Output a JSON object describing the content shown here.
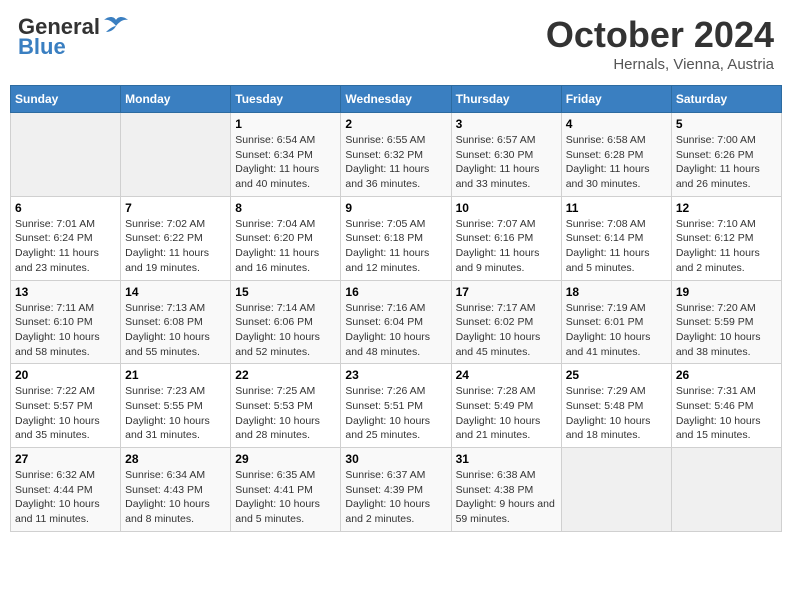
{
  "header": {
    "logo_general": "General",
    "logo_blue": "Blue",
    "month_title": "October 2024",
    "location": "Hernals, Vienna, Austria"
  },
  "days_of_week": [
    "Sunday",
    "Monday",
    "Tuesday",
    "Wednesday",
    "Thursday",
    "Friday",
    "Saturday"
  ],
  "weeks": [
    [
      {
        "day": "",
        "sunrise": "",
        "sunset": "",
        "daylight": ""
      },
      {
        "day": "",
        "sunrise": "",
        "sunset": "",
        "daylight": ""
      },
      {
        "day": "1",
        "sunrise": "Sunrise: 6:54 AM",
        "sunset": "Sunset: 6:34 PM",
        "daylight": "Daylight: 11 hours and 40 minutes."
      },
      {
        "day": "2",
        "sunrise": "Sunrise: 6:55 AM",
        "sunset": "Sunset: 6:32 PM",
        "daylight": "Daylight: 11 hours and 36 minutes."
      },
      {
        "day": "3",
        "sunrise": "Sunrise: 6:57 AM",
        "sunset": "Sunset: 6:30 PM",
        "daylight": "Daylight: 11 hours and 33 minutes."
      },
      {
        "day": "4",
        "sunrise": "Sunrise: 6:58 AM",
        "sunset": "Sunset: 6:28 PM",
        "daylight": "Daylight: 11 hours and 30 minutes."
      },
      {
        "day": "5",
        "sunrise": "Sunrise: 7:00 AM",
        "sunset": "Sunset: 6:26 PM",
        "daylight": "Daylight: 11 hours and 26 minutes."
      }
    ],
    [
      {
        "day": "6",
        "sunrise": "Sunrise: 7:01 AM",
        "sunset": "Sunset: 6:24 PM",
        "daylight": "Daylight: 11 hours and 23 minutes."
      },
      {
        "day": "7",
        "sunrise": "Sunrise: 7:02 AM",
        "sunset": "Sunset: 6:22 PM",
        "daylight": "Daylight: 11 hours and 19 minutes."
      },
      {
        "day": "8",
        "sunrise": "Sunrise: 7:04 AM",
        "sunset": "Sunset: 6:20 PM",
        "daylight": "Daylight: 11 hours and 16 minutes."
      },
      {
        "day": "9",
        "sunrise": "Sunrise: 7:05 AM",
        "sunset": "Sunset: 6:18 PM",
        "daylight": "Daylight: 11 hours and 12 minutes."
      },
      {
        "day": "10",
        "sunrise": "Sunrise: 7:07 AM",
        "sunset": "Sunset: 6:16 PM",
        "daylight": "Daylight: 11 hours and 9 minutes."
      },
      {
        "day": "11",
        "sunrise": "Sunrise: 7:08 AM",
        "sunset": "Sunset: 6:14 PM",
        "daylight": "Daylight: 11 hours and 5 minutes."
      },
      {
        "day": "12",
        "sunrise": "Sunrise: 7:10 AM",
        "sunset": "Sunset: 6:12 PM",
        "daylight": "Daylight: 11 hours and 2 minutes."
      }
    ],
    [
      {
        "day": "13",
        "sunrise": "Sunrise: 7:11 AM",
        "sunset": "Sunset: 6:10 PM",
        "daylight": "Daylight: 10 hours and 58 minutes."
      },
      {
        "day": "14",
        "sunrise": "Sunrise: 7:13 AM",
        "sunset": "Sunset: 6:08 PM",
        "daylight": "Daylight: 10 hours and 55 minutes."
      },
      {
        "day": "15",
        "sunrise": "Sunrise: 7:14 AM",
        "sunset": "Sunset: 6:06 PM",
        "daylight": "Daylight: 10 hours and 52 minutes."
      },
      {
        "day": "16",
        "sunrise": "Sunrise: 7:16 AM",
        "sunset": "Sunset: 6:04 PM",
        "daylight": "Daylight: 10 hours and 48 minutes."
      },
      {
        "day": "17",
        "sunrise": "Sunrise: 7:17 AM",
        "sunset": "Sunset: 6:02 PM",
        "daylight": "Daylight: 10 hours and 45 minutes."
      },
      {
        "day": "18",
        "sunrise": "Sunrise: 7:19 AM",
        "sunset": "Sunset: 6:01 PM",
        "daylight": "Daylight: 10 hours and 41 minutes."
      },
      {
        "day": "19",
        "sunrise": "Sunrise: 7:20 AM",
        "sunset": "Sunset: 5:59 PM",
        "daylight": "Daylight: 10 hours and 38 minutes."
      }
    ],
    [
      {
        "day": "20",
        "sunrise": "Sunrise: 7:22 AM",
        "sunset": "Sunset: 5:57 PM",
        "daylight": "Daylight: 10 hours and 35 minutes."
      },
      {
        "day": "21",
        "sunrise": "Sunrise: 7:23 AM",
        "sunset": "Sunset: 5:55 PM",
        "daylight": "Daylight: 10 hours and 31 minutes."
      },
      {
        "day": "22",
        "sunrise": "Sunrise: 7:25 AM",
        "sunset": "Sunset: 5:53 PM",
        "daylight": "Daylight: 10 hours and 28 minutes."
      },
      {
        "day": "23",
        "sunrise": "Sunrise: 7:26 AM",
        "sunset": "Sunset: 5:51 PM",
        "daylight": "Daylight: 10 hours and 25 minutes."
      },
      {
        "day": "24",
        "sunrise": "Sunrise: 7:28 AM",
        "sunset": "Sunset: 5:49 PM",
        "daylight": "Daylight: 10 hours and 21 minutes."
      },
      {
        "day": "25",
        "sunrise": "Sunrise: 7:29 AM",
        "sunset": "Sunset: 5:48 PM",
        "daylight": "Daylight: 10 hours and 18 minutes."
      },
      {
        "day": "26",
        "sunrise": "Sunrise: 7:31 AM",
        "sunset": "Sunset: 5:46 PM",
        "daylight": "Daylight: 10 hours and 15 minutes."
      }
    ],
    [
      {
        "day": "27",
        "sunrise": "Sunrise: 6:32 AM",
        "sunset": "Sunset: 4:44 PM",
        "daylight": "Daylight: 10 hours and 11 minutes."
      },
      {
        "day": "28",
        "sunrise": "Sunrise: 6:34 AM",
        "sunset": "Sunset: 4:43 PM",
        "daylight": "Daylight: 10 hours and 8 minutes."
      },
      {
        "day": "29",
        "sunrise": "Sunrise: 6:35 AM",
        "sunset": "Sunset: 4:41 PM",
        "daylight": "Daylight: 10 hours and 5 minutes."
      },
      {
        "day": "30",
        "sunrise": "Sunrise: 6:37 AM",
        "sunset": "Sunset: 4:39 PM",
        "daylight": "Daylight: 10 hours and 2 minutes."
      },
      {
        "day": "31",
        "sunrise": "Sunrise: 6:38 AM",
        "sunset": "Sunset: 4:38 PM",
        "daylight": "Daylight: 9 hours and 59 minutes."
      },
      {
        "day": "",
        "sunrise": "",
        "sunset": "",
        "daylight": ""
      },
      {
        "day": "",
        "sunrise": "",
        "sunset": "",
        "daylight": ""
      }
    ]
  ]
}
